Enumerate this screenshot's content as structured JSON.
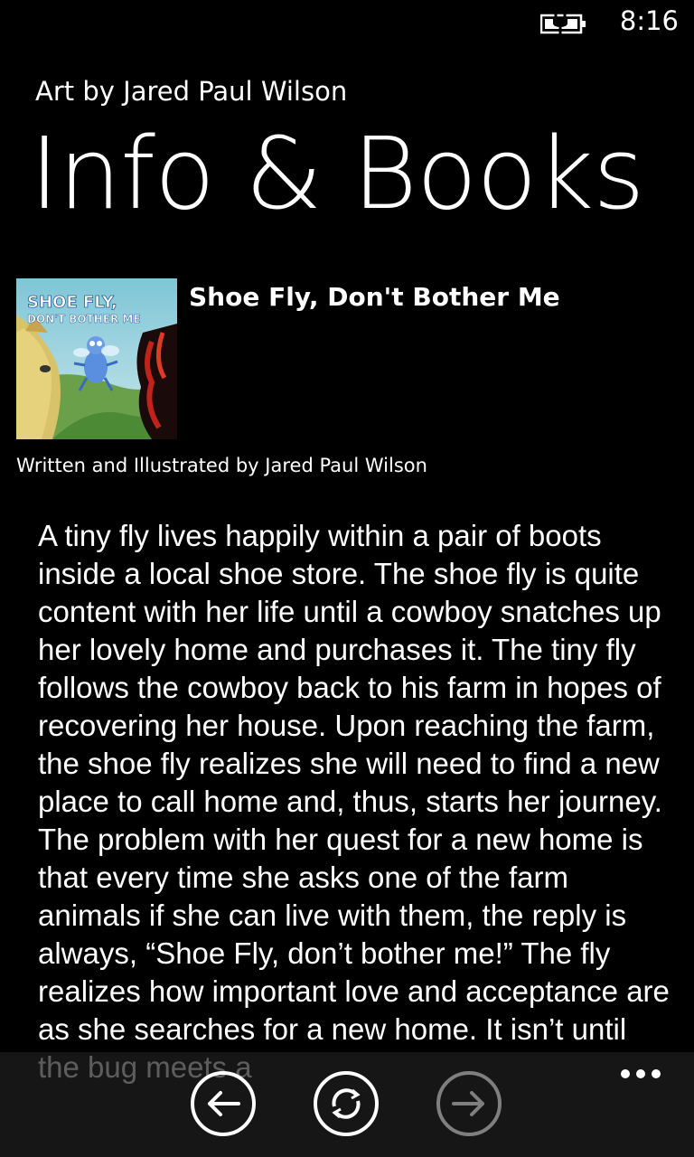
{
  "status": {
    "time": "8:16",
    "battery_icon": "battery-charging-icon"
  },
  "header": {
    "app_title": "Art by Jared Paul Wilson",
    "page_title": "Info & Books"
  },
  "book": {
    "title": "Shoe Fly, Don't Bother Me",
    "credit": "Written and Illustrated by Jared Paul Wilson",
    "cover_line1": "SHOE FLY,",
    "cover_line2": "DON'T BOTHER ME",
    "description": "A tiny fly lives happily within a pair of boots inside a local shoe store. The shoe fly is quite content with her life until a cowboy snatches up her lovely home and purchases it. The tiny fly follows the cowboy back to his farm in hopes of recovering her house. Upon reaching the farm, the shoe fly realizes she will need to find a new place to call home and, thus, starts her journey. The problem with her quest for a new home is that every time she asks one of the farm animals if she can live with them, the reply is always, “Shoe Fly, don’t bother me!” The fly realizes how important love and acceptance are as she searches for a new home. It isn’t until the bug meets a"
  },
  "app_bar": {
    "buttons": [
      {
        "icon": "back-arrow-icon"
      },
      {
        "icon": "sync-icon"
      },
      {
        "icon": "forward-arrow-icon"
      }
    ],
    "more_icon": "more-options-icon"
  },
  "colors": {
    "background": "#000000",
    "text": "#ffffff",
    "app_bar": "#1f1f1f"
  }
}
